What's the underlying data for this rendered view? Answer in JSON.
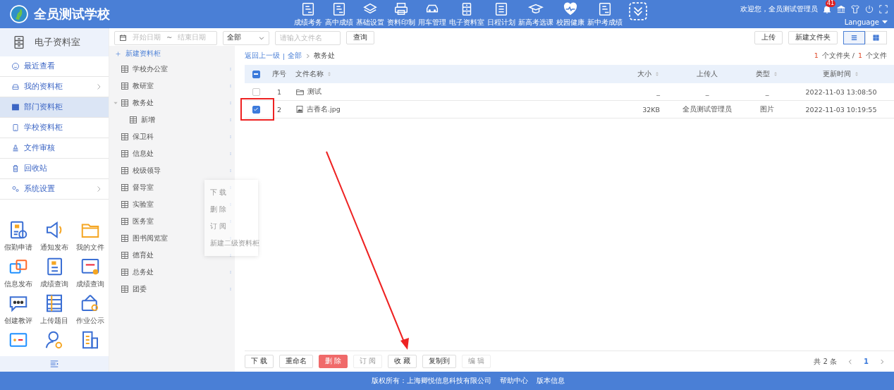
{
  "header": {
    "school": "全员测试学校",
    "apps": [
      {
        "label": "成绩考务"
      },
      {
        "label": "高中成绩"
      },
      {
        "label": "基础设置"
      },
      {
        "label": "资料印制"
      },
      {
        "label": "用车管理"
      },
      {
        "label": "电子资料室"
      },
      {
        "label": "日程计划"
      },
      {
        "label": "新高考选课"
      },
      {
        "label": "校园健康"
      },
      {
        "label": "新中考成绩"
      }
    ],
    "welcome": "欢迎您，全员测试管理员",
    "notification_count": "41",
    "language": "Language"
  },
  "sidebar": {
    "title": "电子资料室",
    "nav": [
      {
        "label": "最近查看",
        "selected": false,
        "has_submenu": false
      },
      {
        "label": "我的资料柜",
        "selected": false,
        "has_submenu": true
      },
      {
        "label": "部门资料柜",
        "selected": true,
        "has_submenu": false
      },
      {
        "label": "学校资料柜",
        "selected": false,
        "has_submenu": false
      },
      {
        "label": "文件审核",
        "selected": false,
        "has_submenu": false
      },
      {
        "label": "回收站",
        "selected": false,
        "has_submenu": false
      },
      {
        "label": "系统设置",
        "selected": false,
        "has_submenu": true
      }
    ],
    "apps": [
      {
        "kind": "app",
        "label": "假勤申请"
      },
      {
        "kind": "app",
        "label": "通知发布"
      },
      {
        "kind": "app",
        "label": "我的文件"
      },
      {
        "kind": "app",
        "label": "信息发布"
      },
      {
        "kind": "app",
        "label": "成绩查询"
      },
      {
        "kind": "app",
        "label": "成绩查询"
      },
      {
        "kind": "app",
        "label": "创建教评"
      },
      {
        "kind": "app",
        "label": "上传题目"
      },
      {
        "kind": "app",
        "label": "作业公示"
      },
      {
        "kind": "app-cut"
      },
      {
        "kind": "app-cut"
      },
      {
        "kind": "app-cut"
      }
    ]
  },
  "filters": {
    "start_placeholder": "开始日期",
    "separator": "~",
    "end_placeholder": "结束日期",
    "type_value": "全部",
    "search_placeholder": "请输入文件名",
    "query_button": "查询"
  },
  "tree": {
    "new_button": "新建资料柜",
    "items": [
      {
        "label": "学校办公室"
      },
      {
        "label": "教研室"
      },
      {
        "label": "教务处",
        "expanded": true,
        "children": [
          {
            "label": "新增"
          }
        ]
      },
      {
        "label": "保卫科"
      },
      {
        "label": "信息处"
      },
      {
        "label": "校级领导"
      },
      {
        "label": "督导室"
      },
      {
        "label": "实验室"
      },
      {
        "label": "医务室"
      },
      {
        "label": "图书阅览室"
      },
      {
        "label": "德育处"
      },
      {
        "label": "总务处"
      },
      {
        "label": "团委"
      }
    ]
  },
  "context_menu": [
    {
      "label": "下 载",
      "disabled": true
    },
    {
      "label": "删 除",
      "disabled": true
    },
    {
      "label": "订 阅",
      "disabled": true
    },
    {
      "label": "新建二级资料柜",
      "disabled": true
    }
  ],
  "toolbar": {
    "buttons": [
      {
        "label": "上传"
      },
      {
        "label": "新建文件夹"
      }
    ],
    "views": [
      {
        "kind": "list",
        "selected": true
      },
      {
        "kind": "grid",
        "selected": false
      }
    ]
  },
  "breadcrumb": {
    "back": "返回上一级",
    "separator": "|",
    "root": "全部",
    "current": "教务处"
  },
  "counts": {
    "folders": "1",
    "folders_label": "个文件夹 /",
    "files": "1",
    "files_label": "个文件"
  },
  "table": {
    "select_all_partial": true,
    "columns": [
      {
        "label": "序号",
        "sortable": false
      },
      {
        "label": "文件名称",
        "sortable": true
      },
      {
        "label": "大小",
        "sortable": true
      },
      {
        "label": "上传人",
        "sortable": false
      },
      {
        "label": "类型",
        "sortable": true
      },
      {
        "label": "更新时间",
        "sortable": true
      }
    ],
    "rows": [
      {
        "checked": false,
        "kind": "folder",
        "cells": [
          "1",
          "测试",
          "_",
          "_",
          "_",
          "2022-11-03 13:08:50"
        ]
      },
      {
        "checked": true,
        "kind": "image",
        "cells": [
          "2",
          "吉香名.jpg",
          "32KB",
          "全员测试管理员",
          "图片",
          "2022-11-03 10:19:55"
        ]
      }
    ]
  },
  "actions": [
    {
      "label": "下 载",
      "kind": "normal",
      "disabled": false
    },
    {
      "label": "重命名",
      "kind": "normal",
      "disabled": false
    },
    {
      "label": "删 除",
      "kind": "danger",
      "disabled": false
    },
    {
      "label": "订 阅",
      "kind": "normal",
      "disabled": true
    },
    {
      "label": "收 藏",
      "kind": "normal",
      "disabled": false
    },
    {
      "label": "复制到",
      "kind": "normal",
      "disabled": false
    },
    {
      "label": "编 辑",
      "kind": "normal",
      "disabled": true
    }
  ],
  "pagination": {
    "total": "共 2 条",
    "pages": [
      {
        "label": "1",
        "selected": true
      }
    ]
  },
  "footer": {
    "copyright": "版权所有：上海卿悦信息科技有限公司",
    "links": [
      "帮助中心",
      "版本信息"
    ]
  }
}
